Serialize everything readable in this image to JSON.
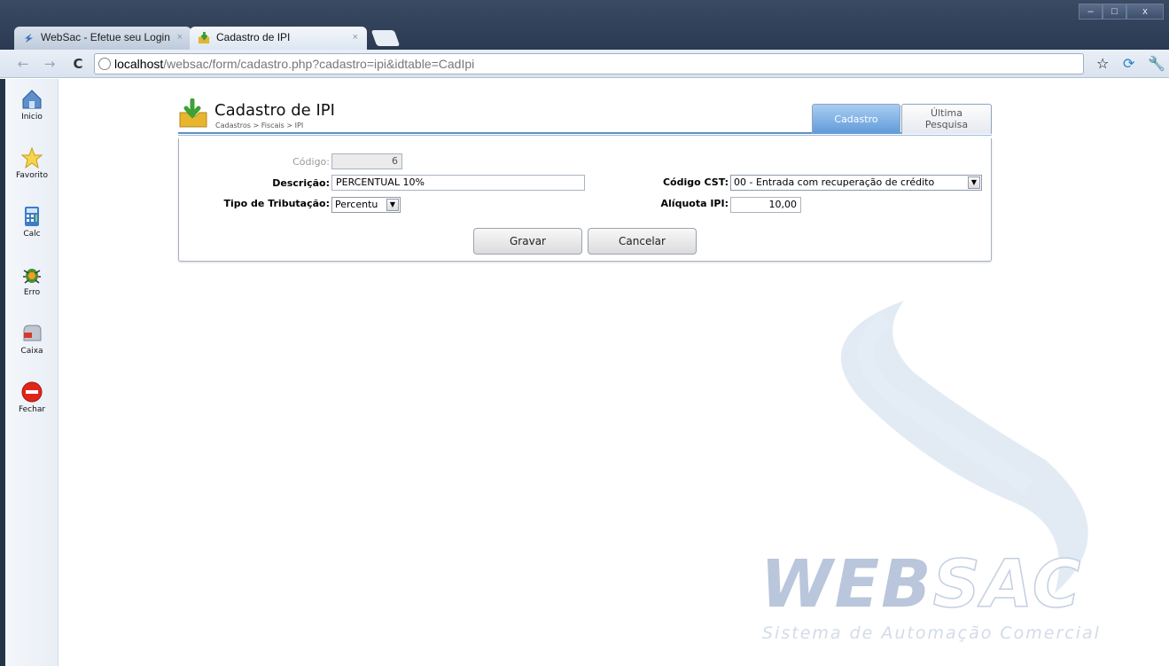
{
  "browser": {
    "tabs": [
      {
        "title": "WebSac - Efetue seu Login",
        "active": false
      },
      {
        "title": "Cadastro de IPI",
        "active": true
      }
    ],
    "tab_close": "×",
    "window_buttons": {
      "minimize": "–",
      "maximize": "□",
      "close": "x"
    },
    "nav": {
      "back": "←",
      "forward": "→",
      "reload": "C"
    },
    "address": {
      "host": "localhost",
      "path": "/websac/form/cadastro.php?cadastro=ipi&idtable=CadIpi"
    },
    "right_icons": {
      "star": "☆",
      "extension": "⟳",
      "wrench": "🔧"
    }
  },
  "sidebar": {
    "items": [
      {
        "label": "Inicio",
        "icon": "home-icon"
      },
      {
        "label": "Favorito",
        "icon": "star-icon"
      },
      {
        "label": "Calc",
        "icon": "calculator-icon"
      },
      {
        "label": "Erro",
        "icon": "bug-icon"
      },
      {
        "label": "Caixa",
        "icon": "mailbox-icon"
      },
      {
        "label": "Fechar",
        "icon": "stop-icon"
      }
    ]
  },
  "form": {
    "title": "Cadastro de IPI",
    "breadcrumb": "Cadastros > Fiscais > IPI",
    "tabs": {
      "cadastro": "Cadastro",
      "ultima_line1": "Última",
      "ultima_line2": "Pesquisa"
    },
    "codigo": {
      "label": "Código:",
      "value": "6"
    },
    "descricao": {
      "label": "Descrição:",
      "value": "PERCENTUAL 10%"
    },
    "tipo_tributacao": {
      "label": "Tipo de Tributação:",
      "value": "Percentu"
    },
    "codigo_cst": {
      "label": "Código CST:",
      "value": "00 - Entrada com recuperação de crédito"
    },
    "aliquota_ipi": {
      "label": "Alíquota IPI:",
      "value": "10,00"
    },
    "buttons": {
      "save": "Gravar",
      "cancel": "Cancelar"
    }
  },
  "watermark": {
    "brand_web": "WEB",
    "brand_sac": "SAC",
    "tagline": "Sistema de Automação Comercial"
  },
  "colors": {
    "accent": "#5f9ad8",
    "chrome": "#2b3a52"
  }
}
